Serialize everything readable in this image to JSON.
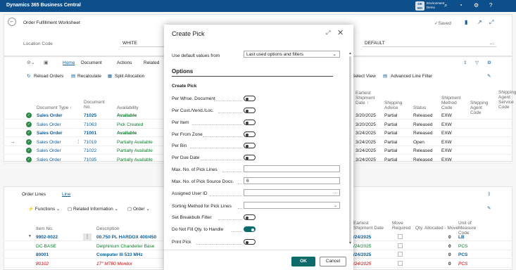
{
  "app": {
    "title": "Dynamics 365 Business Central",
    "avatar": "DE MO",
    "env_line1": "Environment",
    "env_line2": "Demo"
  },
  "page": {
    "title": "Order Fulfillment Worksheet",
    "saved": "✓Saved",
    "location_label": "Location Code",
    "location_value": "WHITE",
    "default_value": "DEFAULT"
  },
  "actions": {
    "home": "Home",
    "document": "Document",
    "actions": "Actions",
    "related": "Related"
  },
  "toolbar": {
    "reload": "Reload Orders",
    "recalc": "Recalculate",
    "split": "Split Allocation",
    "select_view": "Select View",
    "adv_filter": "Advanced Line Filter"
  },
  "orders": {
    "headers": {
      "doc_type": "Document Type ↑",
      "doc_no": "Document No.",
      "availability": "Availability",
      "earliest": "Earliest Shipment Date ↑",
      "advice": "Shipping Advice",
      "status": "Status",
      "method": "Shipment Method Code",
      "agent": "Shipping Agent Code",
      "service": "Shipping Agent Service Code"
    },
    "rows": [
      {
        "type": "Sales Order",
        "no": "71025",
        "avail": "Available",
        "date": "3/20/2025",
        "advice": "Partial",
        "status": "Released",
        "method": "EXW",
        "bold": true,
        "sel": true
      },
      {
        "type": "Sales Order",
        "no": "71063",
        "avail": "Pick Created",
        "date": "3/20/2025",
        "advice": "Partial",
        "status": "Released",
        "method": "EXW",
        "bold": false,
        "sel": true
      },
      {
        "type": "Sales Order",
        "no": "71001",
        "avail": "Available",
        "date": "3/24/2025",
        "advice": "Partial",
        "status": "Released",
        "method": "EXW",
        "bold": true,
        "sel": true
      },
      {
        "type": "Sales Order",
        "no": "71019",
        "avail": "Partially Available",
        "date": "3/24/2025",
        "advice": "Partial",
        "status": "Open",
        "method": "EXW",
        "bold": false,
        "sel": true
      },
      {
        "type": "Sales Order",
        "no": "71022",
        "avail": "Partially Available",
        "date": "3/24/2025",
        "advice": "Partial",
        "status": "Released",
        "method": "EXW",
        "bold": false,
        "sel": true
      },
      {
        "type": "Sales Order",
        "no": "71035",
        "avail": "Partially Available",
        "date": "3/24/2025",
        "advice": "Partial",
        "status": "Released",
        "method": "EXW",
        "bold": false,
        "sel": true
      }
    ]
  },
  "lines": {
    "title": "Order Lines",
    "tab": "Line",
    "functions": "Functions",
    "related_info": "Related Information",
    "order": "Order",
    "headers": {
      "item": "Item No.",
      "desc": "Description",
      "ship": "Earliest Shipment Date",
      "move": "Move Required",
      "qty": "Qty. Allocated - Move",
      "uom": "Unit of Measure Code"
    },
    "rows": [
      {
        "item": "9902-0022",
        "desc": "00.750 PL HARDOX 400/450",
        "date": "/24/2025",
        "qty": "0",
        "uom": "LB",
        "style": "bold"
      },
      {
        "item": "DC-BASE",
        "desc": "Delphinium Chandelier Base",
        "date": "/24/2025",
        "qty": "0",
        "uom": "PCS",
        "style": "green"
      },
      {
        "item": "80001",
        "desc": "Computer III 533 MHz",
        "date": "/24/2025",
        "qty": "0",
        "uom": "PCS",
        "style": "bold"
      },
      {
        "item": "80102",
        "desc": "17\" M780 Monitor",
        "date": "/24/2025",
        "qty": "0",
        "uom": "PCS",
        "style": "red"
      }
    ]
  },
  "dialog": {
    "title": "Create Pick",
    "use_default_label": "Use default values from",
    "use_default_value": "Last used options and filters",
    "options_heading": "Options",
    "create_pick_heading": "Create Pick",
    "fields": [
      {
        "label": "Per Whse. Document",
        "kind": "toggle",
        "on": false
      },
      {
        "label": "Per Cust./Vend./Loc.",
        "kind": "toggle",
        "on": false
      },
      {
        "label": "Per Item",
        "kind": "toggle",
        "on": false
      },
      {
        "label": "Per From Zone",
        "kind": "toggle",
        "on": false
      },
      {
        "label": "Per Bin",
        "kind": "toggle",
        "on": false
      },
      {
        "label": "Per Due Date",
        "kind": "toggle",
        "on": false
      },
      {
        "label": "Max. No. of Pick Lines",
        "kind": "text",
        "value": ""
      },
      {
        "label": "Max. No. of Pick Source Docs.",
        "kind": "text",
        "value": "6"
      },
      {
        "label": "Assigned User ID",
        "kind": "lookup",
        "value": ""
      },
      {
        "label": "Sorting Method for Pick Lines",
        "kind": "select",
        "value": ""
      },
      {
        "label": "Set Breakbulk Filter",
        "kind": "toggle",
        "on": false
      },
      {
        "label": "Do Not Fill Qty. to Handle",
        "kind": "toggle",
        "on": true
      },
      {
        "label": "Print Pick",
        "kind": "toggle",
        "on": false
      }
    ],
    "ok": "OK",
    "cancel": "Cancel"
  }
}
